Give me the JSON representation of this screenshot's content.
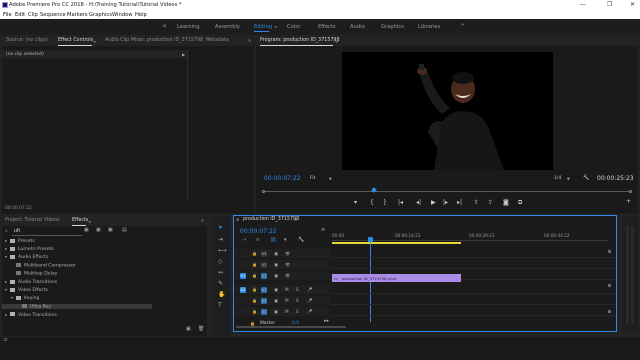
{
  "titlebar": {
    "title": "Adobe Premiere Pro CC 2018 - H:\\Training Tutorial\\Tutorial Videos *"
  },
  "menu": [
    "File",
    "Edit",
    "Clip",
    "Sequence",
    "Markers",
    "Graphics",
    "Window",
    "Help"
  ],
  "workspaces": [
    "Learning",
    "Assembly",
    "Editing",
    "Color",
    "Effects",
    "Audio",
    "Graphics",
    "Libraries"
  ],
  "workspace_active": "Editing",
  "source_panel": {
    "tabs": [
      "Source: (no clips)",
      "Effect Controls",
      "Audio Clip Mixer: production ID_3715798",
      "Metadata"
    ],
    "no_clip": "(no clip selected)",
    "timecode": "00:00:07:22"
  },
  "program": {
    "title": "Program: production ID_3715798",
    "timecode": "00:00:07:22",
    "fit": "Fit",
    "quality": "1/4",
    "duration": "00:00:25:23"
  },
  "project_panel": {
    "tabs": [
      "Project: Tutorial Videos",
      "Effects"
    ],
    "search": "ult",
    "tree": [
      {
        "label": "Presets",
        "indent": 0,
        "open": false
      },
      {
        "label": "Lumetri Presets",
        "indent": 0,
        "open": false
      },
      {
        "label": "Audio Effects",
        "indent": 0,
        "open": true
      },
      {
        "label": "Multiband Compressor",
        "indent": 1,
        "open": null
      },
      {
        "label": "Multitap Delay",
        "indent": 1,
        "open": null
      },
      {
        "label": "Audio Transitions",
        "indent": 0,
        "open": false
      },
      {
        "label": "Video Effects",
        "indent": 0,
        "open": true
      },
      {
        "label": "Keying",
        "indent": 1,
        "open": true
      },
      {
        "label": "Ultra Key",
        "indent": 2,
        "open": null
      },
      {
        "label": "Video Transitions",
        "indent": 0,
        "open": false
      }
    ]
  },
  "timeline": {
    "sequence_tab": "production ID_3715798",
    "timecode": "00:00:07:22",
    "ruler": [
      "00:00",
      "00:00:14:23",
      "00:00:29:23",
      "00:00:44:22"
    ],
    "video_tracks": [
      "V3",
      "V2",
      "V1"
    ],
    "audio_tracks": [
      "A1",
      "A2",
      "A3"
    ],
    "master_label": "Master",
    "master_value": "0.0",
    "clip_label": "production ID_3715798.mp4",
    "clip_icon": "fx",
    "source_patch_v": "V1",
    "source_patch_a": "A1"
  },
  "colors": {
    "accent": "#2d8ceb",
    "clip": "#a98ce6",
    "playhead": "#2d8ceb",
    "work_area": "#e6d833"
  }
}
